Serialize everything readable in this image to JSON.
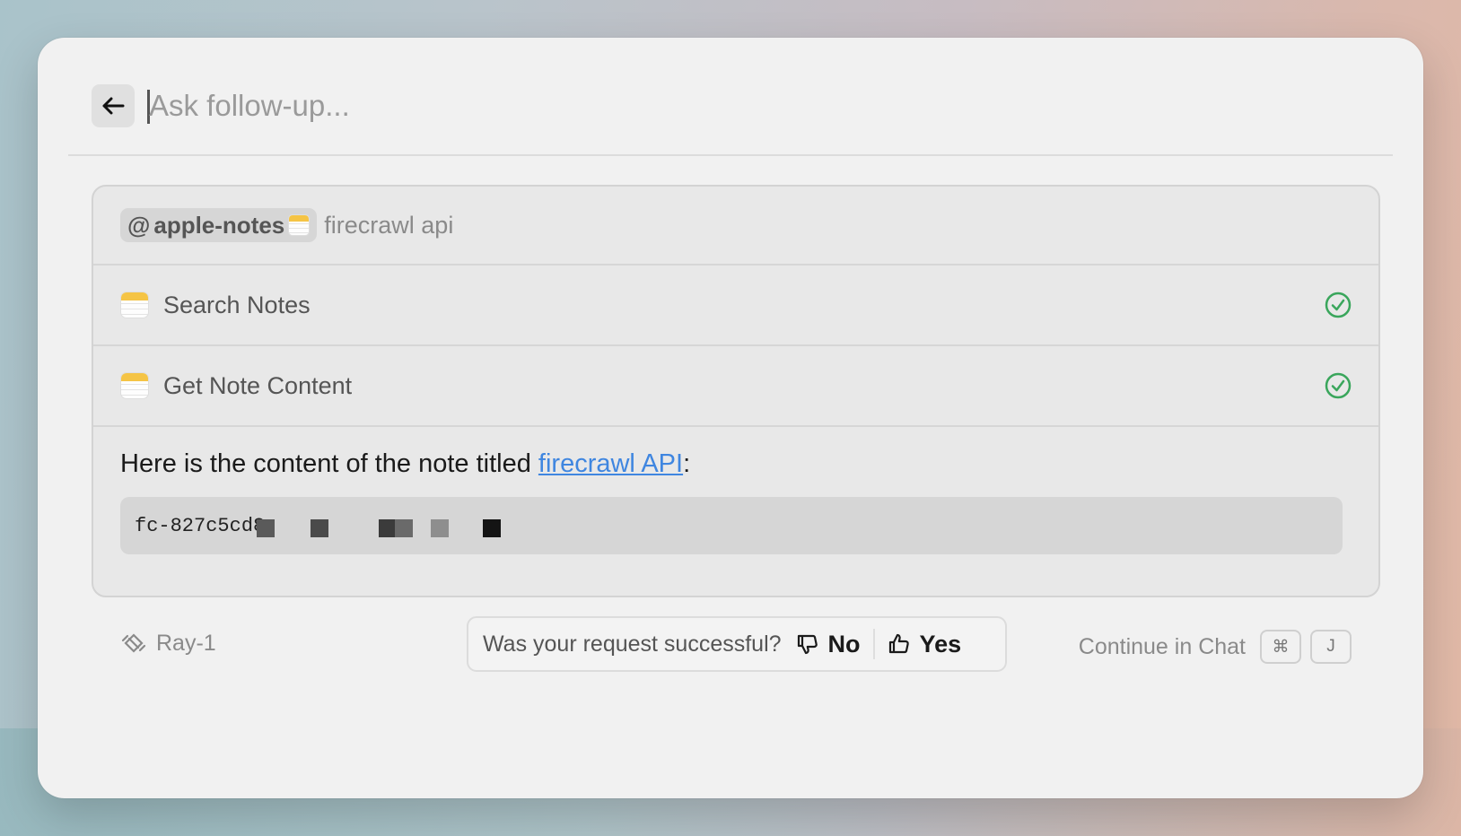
{
  "search": {
    "placeholder": "Ask follow-up..."
  },
  "query": {
    "mention": {
      "at": "@",
      "label": "apple-notes",
      "icon": "apple-notes-icon"
    },
    "text": "firecrawl api"
  },
  "tools": [
    {
      "label": "Search Notes",
      "status": "success",
      "icon": "apple-notes-icon"
    },
    {
      "label": "Get Note Content",
      "status": "success",
      "icon": "apple-notes-icon"
    }
  ],
  "answer": {
    "prefix": "Here is the content of the note titled ",
    "link_text": "firecrawl API",
    "suffix": ":",
    "code": "fc-827c5cd8"
  },
  "footer": {
    "model": "Ray-1",
    "feedback_question": "Was your request successful?",
    "no_label": "No",
    "yes_label": "Yes",
    "continue_label": "Continue in Chat",
    "shortcut_keys": [
      "⌘",
      "J"
    ]
  },
  "colors": {
    "success": "#3aa65c",
    "link": "#3f86e0",
    "notes_accent": "#f5c445"
  }
}
